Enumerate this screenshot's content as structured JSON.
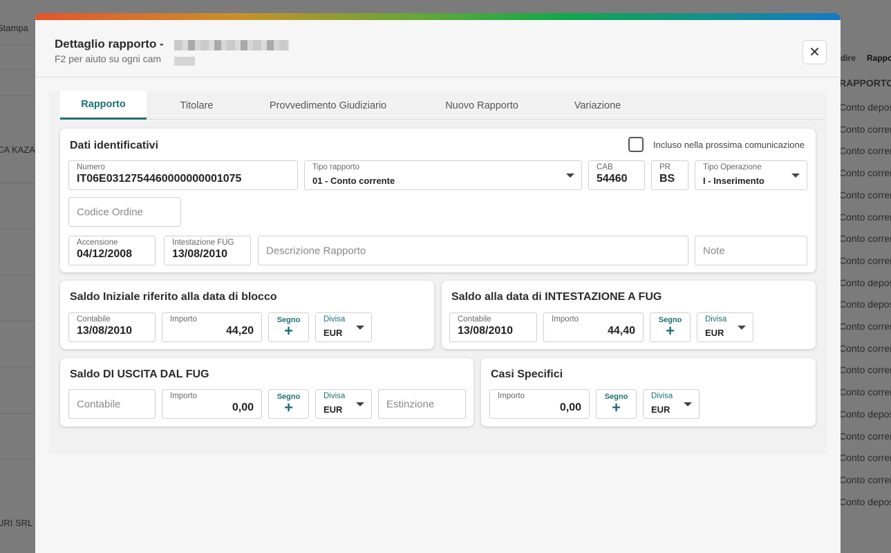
{
  "background": {
    "left_texts": [
      "Stampa",
      "CA KAZA",
      "URI SRL"
    ],
    "right_texts": {
      "top": [
        "dire",
        "Rappo"
      ],
      "header": "RAPPORTO",
      "rows": [
        "Conto depos",
        "Conto corren",
        "Conto corren",
        "Conto corren",
        "Conto corren",
        "Conto corren",
        "Conto corren",
        "Conto corren",
        "Conto depos",
        "Conto depos",
        "Conto corren",
        "Conto corren",
        "Conto corren",
        "Conto corren",
        "Conto depos",
        "Conto corren",
        "Conto corren",
        "Conto corren",
        "Conto depos"
      ]
    }
  },
  "modal": {
    "title": "Dettaglio rapporto -",
    "subtitle": "F2 per aiuto su ogni cam",
    "close_glyph": "✕",
    "accent_colors": [
      "#e2552e",
      "#12a94a",
      "#1479c6"
    ]
  },
  "tabs": [
    {
      "label": "Rapporto",
      "active": true
    },
    {
      "label": "Titolare",
      "active": false
    },
    {
      "label": "Provvedimento Giudiziario",
      "active": false
    },
    {
      "label": "Nuovo Rapporto",
      "active": false
    },
    {
      "label": "Variazione",
      "active": false
    }
  ],
  "dati": {
    "title": "Dati identificativi",
    "incluso_label": "Incluso nella prossima comunicazione",
    "incluso_checked": false,
    "numero": {
      "label": "Numero",
      "value": "IT06E0312754460000000001075"
    },
    "tipo_rapporto": {
      "label": "Tipo rapporto",
      "value": "01 - Conto corrente"
    },
    "cab": {
      "label": "CAB",
      "value": "54460"
    },
    "pr": {
      "label": "PR",
      "value": "BS"
    },
    "tipo_operazione": {
      "label": "Tipo Operazione",
      "value": "I - Inserimento"
    },
    "codice_ordine": {
      "placeholder": "Codice Ordine"
    },
    "accensione": {
      "label": "Accensione",
      "value": "04/12/2008"
    },
    "intestazione_fug": {
      "label": "Intestazione FUG",
      "value": "13/08/2010"
    },
    "descrizione": {
      "placeholder": "Descrizione Rapporto"
    },
    "note": {
      "placeholder": "Note"
    }
  },
  "saldo_iniziale": {
    "title": "Saldo Iniziale riferito alla data di blocco",
    "contabile": {
      "label": "Contabile",
      "value": "13/08/2010"
    },
    "importo": {
      "label": "Importo",
      "value": "44,20"
    },
    "segno": {
      "label": "Segno",
      "value": "+"
    },
    "divisa": {
      "label": "Divisa",
      "value": "EUR"
    }
  },
  "saldo_fug": {
    "title": "Saldo alla data di INTESTAZIONE A FUG",
    "contabile": {
      "label": "Contabile",
      "value": "13/08/2010"
    },
    "importo": {
      "label": "Importo",
      "value": "44,40"
    },
    "segno": {
      "label": "Segno",
      "value": "+"
    },
    "divisa": {
      "label": "Divisa",
      "value": "EUR"
    }
  },
  "saldo_uscita": {
    "title": "Saldo DI USCITA DAL FUG",
    "contabile": {
      "placeholder": "Contabile"
    },
    "importo": {
      "label": "Importo",
      "value": "0,00"
    },
    "segno": {
      "label": "Segno",
      "value": "+"
    },
    "divisa": {
      "label": "Divisa",
      "value": "EUR"
    },
    "estinzione": {
      "placeholder": "Estinzione"
    }
  },
  "casi_specifici": {
    "title": "Casi Specifici",
    "importo": {
      "label": "Importo",
      "value": "0,00"
    },
    "segno": {
      "label": "Segno",
      "value": "+"
    },
    "divisa": {
      "label": "Divisa",
      "value": "EUR"
    }
  }
}
